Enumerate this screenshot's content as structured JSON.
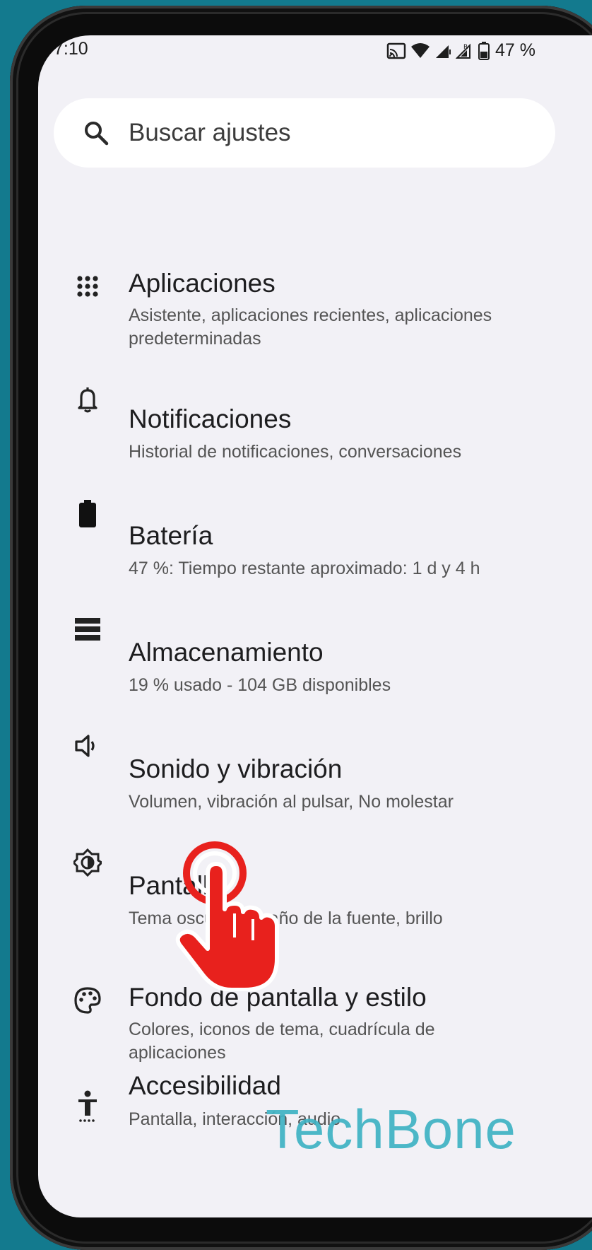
{
  "status_bar": {
    "time": "7:10",
    "battery_percent": "47 %"
  },
  "search": {
    "placeholder": "Buscar ajustes"
  },
  "settings": [
    {
      "title": "Aplicaciones",
      "subtitle": "Asistente, aplicaciones recientes, aplicaciones predeterminadas",
      "icon": "apps-grid-icon"
    },
    {
      "title": "Notificaciones",
      "subtitle": "Historial de notificaciones, conversaciones",
      "icon": "bell-icon"
    },
    {
      "title": "Batería",
      "subtitle": "47 %: Tiempo restante aproximado: 1 d y 4 h",
      "icon": "battery-icon"
    },
    {
      "title": "Almacenamiento",
      "subtitle": "19 % usado - 104 GB disponibles",
      "icon": "storage-icon"
    },
    {
      "title": "Sonido y vibración",
      "subtitle": "Volumen, vibración al pulsar, No molestar",
      "icon": "speaker-icon"
    },
    {
      "title": "Pantalla",
      "subtitle": "Tema oscuro, tamaño de la fuente, brillo",
      "icon": "brightness-icon"
    },
    {
      "title": "Fondo de pantalla y estilo",
      "subtitle": "Colores, iconos de tema, cuadrícula de aplicaciones",
      "icon": "palette-icon"
    },
    {
      "title": "Accesibilidad",
      "subtitle": "Pantalla, interacción, audio",
      "icon": "accessibility-icon"
    }
  ],
  "watermark": "TechBone",
  "colors": {
    "background": "#137a8e",
    "screen": "#f2f1f6",
    "tap_indicator": "#e8211d",
    "watermark": "#3fb3c4"
  }
}
